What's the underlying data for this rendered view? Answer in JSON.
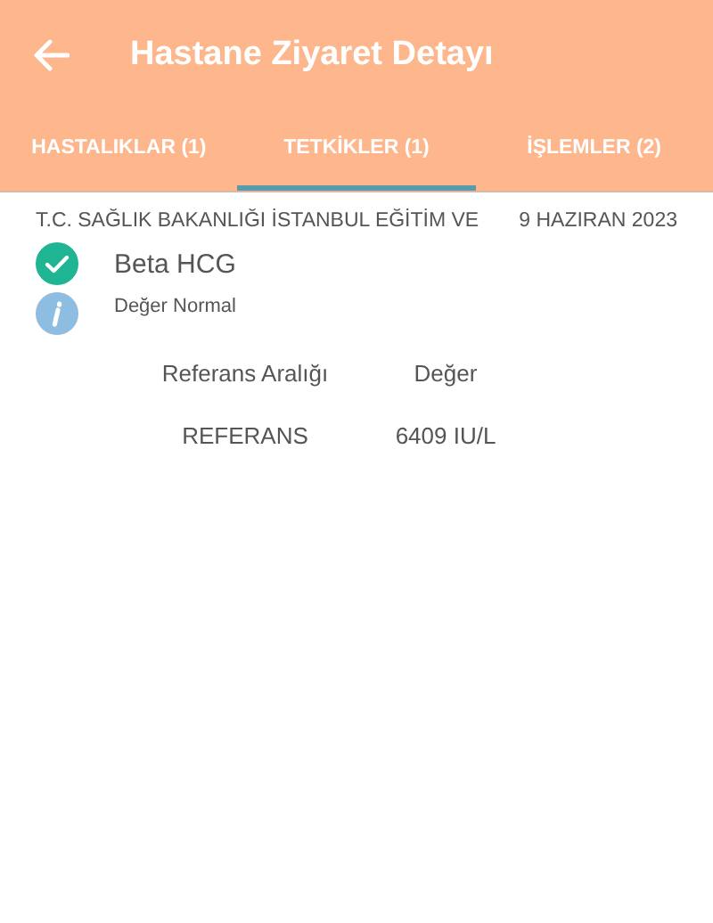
{
  "app_bar": {
    "title": "Hastane Ziyaret Detayı"
  },
  "tabs": [
    {
      "label": "HASTALIKLAR (1)",
      "selected": false
    },
    {
      "label": "TETKİKLER (1)",
      "selected": true
    },
    {
      "label": "İŞLEMLER (2)",
      "selected": false
    }
  ],
  "visit": {
    "hospital": "T.C. SAĞLIK BAKANLIĞI İSTANBUL EĞİTİM VE",
    "date": "9 HAZIRAN 2023"
  },
  "test": {
    "name": "Beta HCG",
    "status": "Değer Normal",
    "normal": true
  },
  "table": {
    "columns": [
      "Referans Aralığı",
      "Değer"
    ],
    "rows": [
      [
        "REFERANS",
        "6409 IU/L"
      ]
    ]
  }
}
